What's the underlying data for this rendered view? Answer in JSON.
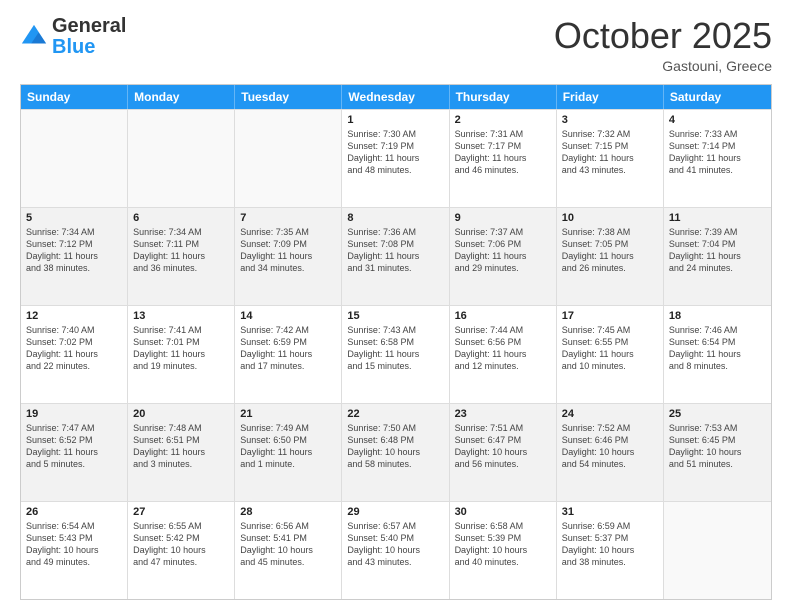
{
  "logo": {
    "general": "General",
    "blue": "Blue"
  },
  "title": "October 2025",
  "location": "Gastouni, Greece",
  "days_of_week": [
    "Sunday",
    "Monday",
    "Tuesday",
    "Wednesday",
    "Thursday",
    "Friday",
    "Saturday"
  ],
  "weeks": [
    [
      {
        "day": "",
        "info": ""
      },
      {
        "day": "",
        "info": ""
      },
      {
        "day": "",
        "info": ""
      },
      {
        "day": "1",
        "info": "Sunrise: 7:30 AM\nSunset: 7:19 PM\nDaylight: 11 hours\nand 48 minutes."
      },
      {
        "day": "2",
        "info": "Sunrise: 7:31 AM\nSunset: 7:17 PM\nDaylight: 11 hours\nand 46 minutes."
      },
      {
        "day": "3",
        "info": "Sunrise: 7:32 AM\nSunset: 7:15 PM\nDaylight: 11 hours\nand 43 minutes."
      },
      {
        "day": "4",
        "info": "Sunrise: 7:33 AM\nSunset: 7:14 PM\nDaylight: 11 hours\nand 41 minutes."
      }
    ],
    [
      {
        "day": "5",
        "info": "Sunrise: 7:34 AM\nSunset: 7:12 PM\nDaylight: 11 hours\nand 38 minutes."
      },
      {
        "day": "6",
        "info": "Sunrise: 7:34 AM\nSunset: 7:11 PM\nDaylight: 11 hours\nand 36 minutes."
      },
      {
        "day": "7",
        "info": "Sunrise: 7:35 AM\nSunset: 7:09 PM\nDaylight: 11 hours\nand 34 minutes."
      },
      {
        "day": "8",
        "info": "Sunrise: 7:36 AM\nSunset: 7:08 PM\nDaylight: 11 hours\nand 31 minutes."
      },
      {
        "day": "9",
        "info": "Sunrise: 7:37 AM\nSunset: 7:06 PM\nDaylight: 11 hours\nand 29 minutes."
      },
      {
        "day": "10",
        "info": "Sunrise: 7:38 AM\nSunset: 7:05 PM\nDaylight: 11 hours\nand 26 minutes."
      },
      {
        "day": "11",
        "info": "Sunrise: 7:39 AM\nSunset: 7:04 PM\nDaylight: 11 hours\nand 24 minutes."
      }
    ],
    [
      {
        "day": "12",
        "info": "Sunrise: 7:40 AM\nSunset: 7:02 PM\nDaylight: 11 hours\nand 22 minutes."
      },
      {
        "day": "13",
        "info": "Sunrise: 7:41 AM\nSunset: 7:01 PM\nDaylight: 11 hours\nand 19 minutes."
      },
      {
        "day": "14",
        "info": "Sunrise: 7:42 AM\nSunset: 6:59 PM\nDaylight: 11 hours\nand 17 minutes."
      },
      {
        "day": "15",
        "info": "Sunrise: 7:43 AM\nSunset: 6:58 PM\nDaylight: 11 hours\nand 15 minutes."
      },
      {
        "day": "16",
        "info": "Sunrise: 7:44 AM\nSunset: 6:56 PM\nDaylight: 11 hours\nand 12 minutes."
      },
      {
        "day": "17",
        "info": "Sunrise: 7:45 AM\nSunset: 6:55 PM\nDaylight: 11 hours\nand 10 minutes."
      },
      {
        "day": "18",
        "info": "Sunrise: 7:46 AM\nSunset: 6:54 PM\nDaylight: 11 hours\nand 8 minutes."
      }
    ],
    [
      {
        "day": "19",
        "info": "Sunrise: 7:47 AM\nSunset: 6:52 PM\nDaylight: 11 hours\nand 5 minutes."
      },
      {
        "day": "20",
        "info": "Sunrise: 7:48 AM\nSunset: 6:51 PM\nDaylight: 11 hours\nand 3 minutes."
      },
      {
        "day": "21",
        "info": "Sunrise: 7:49 AM\nSunset: 6:50 PM\nDaylight: 11 hours\nand 1 minute."
      },
      {
        "day": "22",
        "info": "Sunrise: 7:50 AM\nSunset: 6:48 PM\nDaylight: 10 hours\nand 58 minutes."
      },
      {
        "day": "23",
        "info": "Sunrise: 7:51 AM\nSunset: 6:47 PM\nDaylight: 10 hours\nand 56 minutes."
      },
      {
        "day": "24",
        "info": "Sunrise: 7:52 AM\nSunset: 6:46 PM\nDaylight: 10 hours\nand 54 minutes."
      },
      {
        "day": "25",
        "info": "Sunrise: 7:53 AM\nSunset: 6:45 PM\nDaylight: 10 hours\nand 51 minutes."
      }
    ],
    [
      {
        "day": "26",
        "info": "Sunrise: 6:54 AM\nSunset: 5:43 PM\nDaylight: 10 hours\nand 49 minutes."
      },
      {
        "day": "27",
        "info": "Sunrise: 6:55 AM\nSunset: 5:42 PM\nDaylight: 10 hours\nand 47 minutes."
      },
      {
        "day": "28",
        "info": "Sunrise: 6:56 AM\nSunset: 5:41 PM\nDaylight: 10 hours\nand 45 minutes."
      },
      {
        "day": "29",
        "info": "Sunrise: 6:57 AM\nSunset: 5:40 PM\nDaylight: 10 hours\nand 43 minutes."
      },
      {
        "day": "30",
        "info": "Sunrise: 6:58 AM\nSunset: 5:39 PM\nDaylight: 10 hours\nand 40 minutes."
      },
      {
        "day": "31",
        "info": "Sunrise: 6:59 AM\nSunset: 5:37 PM\nDaylight: 10 hours\nand 38 minutes."
      },
      {
        "day": "",
        "info": ""
      }
    ]
  ],
  "colors": {
    "header_bg": "#2979c8",
    "shaded_row": "#f2f2f2",
    "border": "#cccccc"
  }
}
